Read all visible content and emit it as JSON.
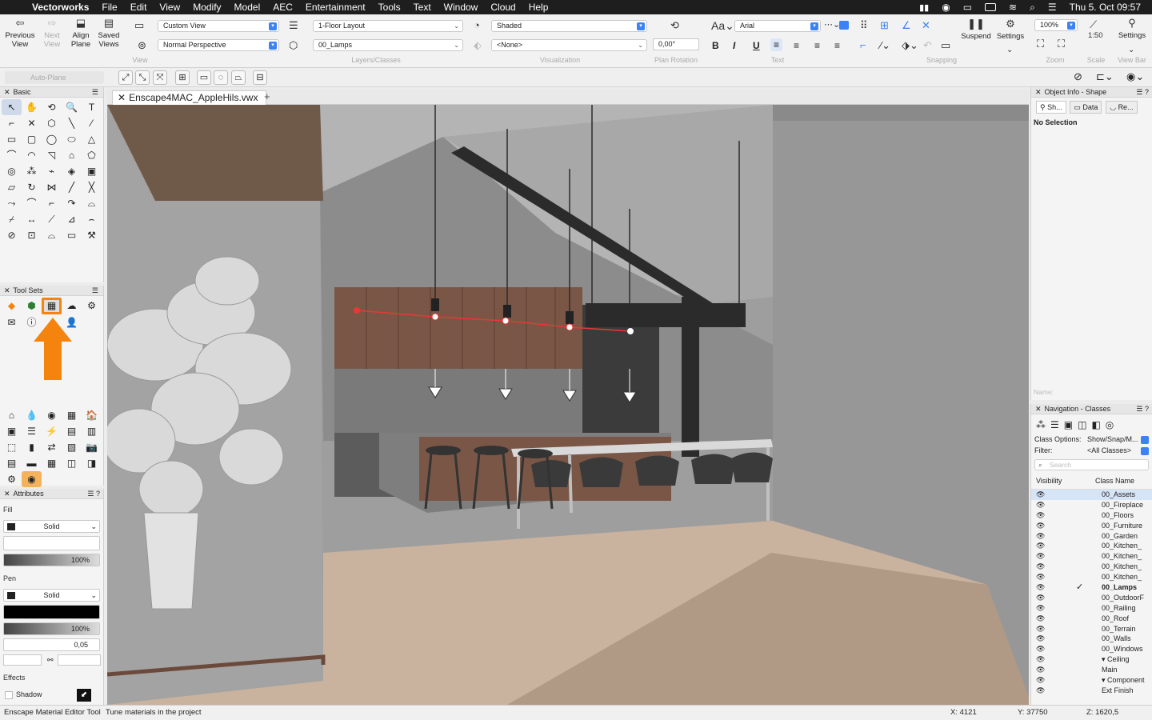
{
  "menubar": {
    "app_name": "Vectorworks",
    "menus": [
      "File",
      "Edit",
      "View",
      "Modify",
      "Model",
      "AEC",
      "Entertainment",
      "Tools",
      "Text",
      "Window",
      "Cloud",
      "Help"
    ],
    "clock": "Thu 5. Oct  09:57"
  },
  "toolbar": {
    "previous_view": "Previous View",
    "next_view": "Next View",
    "align_plane": "Align Plane",
    "saved_views": "Saved Views",
    "view_select": "Custom View",
    "projection_select": "Normal Perspective",
    "view_label": "View",
    "layer_select": "1-Floor Layout",
    "class_select": "00_Lamps",
    "layers_classes_label": "Layers/Classes",
    "render_select": "Shaded",
    "render_sub": "<None>",
    "visualization_label": "Visualization",
    "plan_rotation_value": "0,00°",
    "plan_rotation_label": "Plan Rotation",
    "font_select": "Arial",
    "text_label": "Text",
    "snapping_label": "Snapping",
    "suspend": "Suspend",
    "settings": "Settings",
    "zoom_value": "100%",
    "zoom_label": "Zoom",
    "scale_value": "1:50",
    "scale_label": "Scale",
    "settings2": "Settings",
    "viewbar_label": "View Bar"
  },
  "row2": {
    "auto_plane": "Auto-Plane"
  },
  "basic_palette": {
    "title": "Basic",
    "tools": [
      "↖",
      "✋",
      "⟲",
      "🔍",
      "T",
      "⌐",
      "✕",
      "⬡",
      "╲",
      "⁄",
      "▭",
      "▢",
      "◯",
      "⬭",
      "△",
      "⌒",
      "◠",
      "◹",
      "⌂",
      "⬠",
      "◎",
      "⁂",
      "⌁",
      "◈",
      "▣",
      "▱",
      "↻",
      "⋈",
      "╱",
      "╳",
      "⤳",
      "⌒",
      "⌐",
      "↷",
      "⌓",
      "⌿",
      "↔",
      "⟋",
      "⊿",
      "⌢",
      "⊘",
      "⊡",
      "⌓",
      "▭",
      "⚒"
    ]
  },
  "toolsets_palette": {
    "title": "Tool Sets",
    "tools_row1": [
      "◆",
      "⬢",
      "▦",
      "☁",
      "⚙"
    ],
    "tools_row2": [
      "✉",
      "ⓘ",
      "",
      "👤",
      ""
    ],
    "lower_tools": [
      "⌂",
      "💧",
      "◉",
      "▦",
      "🏠",
      "▣",
      "☰",
      "⚡",
      "▤",
      "▥",
      "⬚",
      "▮",
      "⇄",
      "▧",
      "📷",
      "▤",
      "▬",
      "▦",
      "◫",
      "◨",
      "⚙",
      "◉"
    ]
  },
  "attributes": {
    "title": "Attributes",
    "fill_label": "Fill",
    "fill_style": "Solid",
    "fill_opacity": "100%",
    "pen_label": "Pen",
    "pen_style": "Solid",
    "pen_opacity": "100%",
    "line_weight": "0,05",
    "effects_label": "Effects",
    "shadow_label": "Shadow"
  },
  "document": {
    "tab_title": "Enscape4MAC_AppleHils.vwx"
  },
  "object_info": {
    "title": "Object Info - Shape",
    "tabs": [
      "Sh...",
      "Data",
      "Re..."
    ],
    "selection": "No Selection",
    "name_placeholder": "Name:"
  },
  "navigation": {
    "title": "Navigation - Classes",
    "class_options_label": "Class Options:",
    "class_options_value": "Show/Snap/M...",
    "filter_label": "Filter:",
    "filter_value": "<All Classes>",
    "search_placeholder": "Search",
    "col_visibility": "Visibility",
    "col_class_name": "Class Name",
    "classes": [
      {
        "name": "00_Assets",
        "active": false,
        "highlight": true
      },
      {
        "name": "00_Fireplace",
        "active": false
      },
      {
        "name": "00_Floors",
        "active": false
      },
      {
        "name": "00_Furniture",
        "active": false
      },
      {
        "name": "00_Garden",
        "active": false
      },
      {
        "name": "00_Kitchen_",
        "active": false
      },
      {
        "name": "00_Kitchen_",
        "active": false
      },
      {
        "name": "00_Kitchen_",
        "active": false
      },
      {
        "name": "00_Kitchen_",
        "active": false
      },
      {
        "name": "00_Lamps",
        "active": true
      },
      {
        "name": "00_OutdoorF",
        "active": false
      },
      {
        "name": "00_Railing",
        "active": false
      },
      {
        "name": "00_Roof",
        "active": false
      },
      {
        "name": "00_Terrain",
        "active": false
      },
      {
        "name": "00_Walls",
        "active": false
      },
      {
        "name": "00_Windows",
        "active": false
      },
      {
        "name": "▾ Ceiling",
        "active": false
      },
      {
        "name": "Main",
        "active": false
      },
      {
        "name": "▾ Component",
        "active": false
      },
      {
        "name": "Ext Finish",
        "active": false
      }
    ]
  },
  "status_bar": {
    "tool_name": "Enscape Material Editor Tool",
    "tool_hint": "Tune materials in the project",
    "x": "X: 4121",
    "y": "Y: 37750",
    "z": "Z: 1620,5"
  },
  "colors": {
    "accent": "#3b82f6",
    "highlight_orange": "#f5840f",
    "cabinet_wood": "#7a5646",
    "floor": "#c9b29e"
  }
}
